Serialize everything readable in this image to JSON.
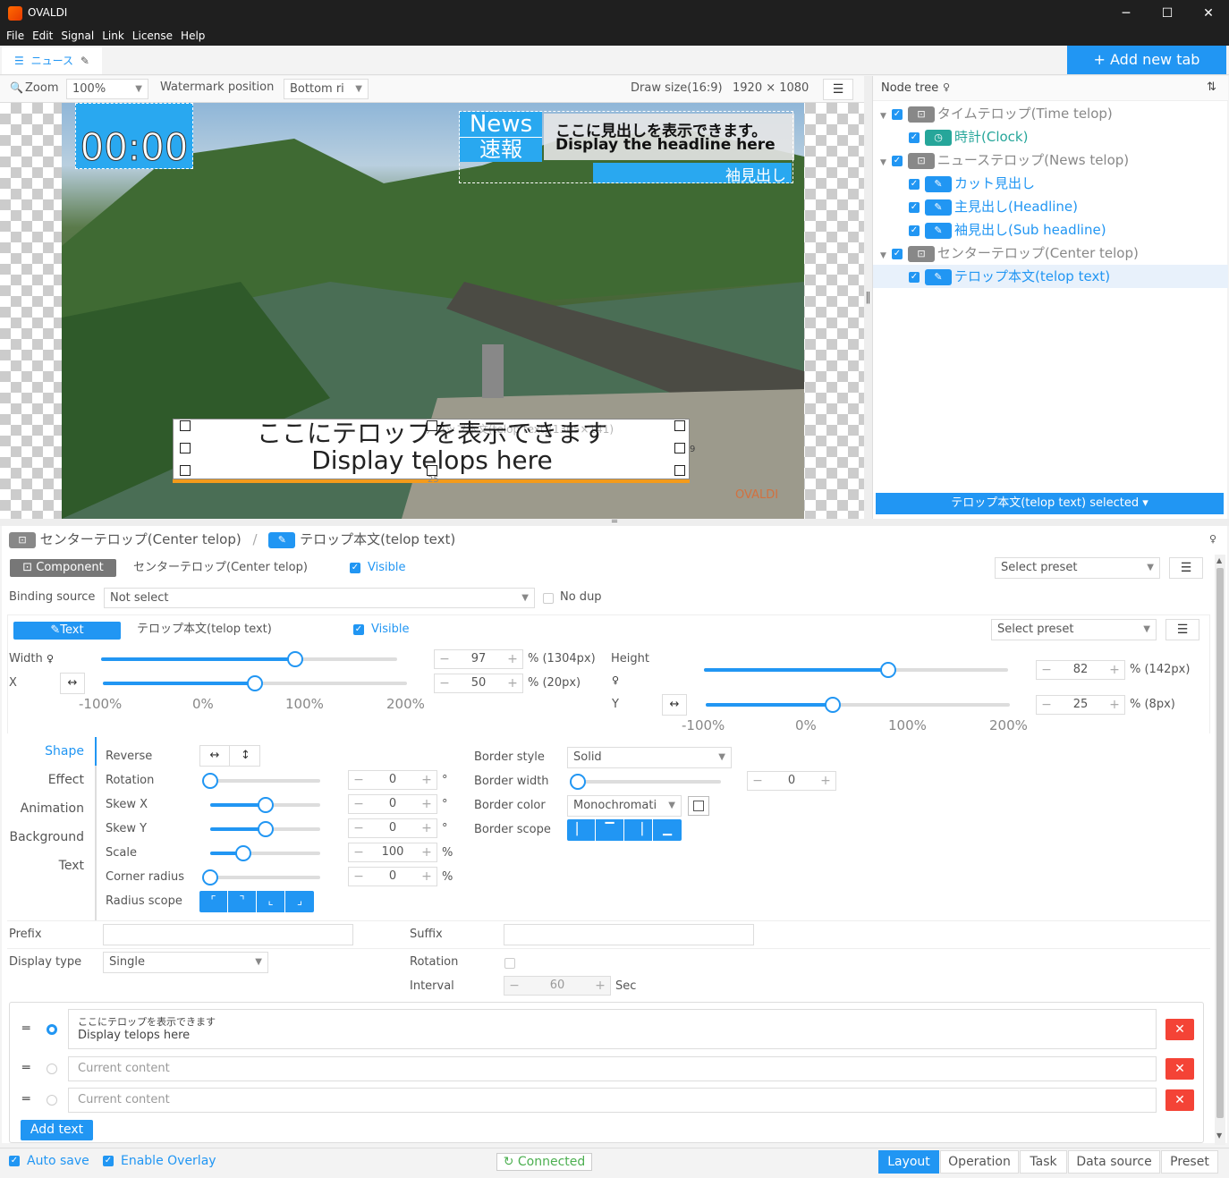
{
  "app": {
    "title": "OVALDI",
    "menu": [
      "File",
      "Edit",
      "Signal",
      "Link",
      "License",
      "Help"
    ]
  },
  "tabs": {
    "active_label": "ニュース",
    "add_label": "+ Add new tab"
  },
  "toolbar": {
    "zoom_label": "Zoom",
    "zoom_value": "100%",
    "watermark_label": "Watermark position",
    "watermark_value": "Bottom ri",
    "draw_size_label": "Draw size(16:9)",
    "draw_size_value": "1920 × 1080"
  },
  "preview": {
    "clock": "00:00",
    "news_top": "News",
    "news_bottom": "速報",
    "headline_jp": "ここに見出しを表示できます。",
    "headline_en": "Display the headline here",
    "subhead": "袖見出し",
    "telop_jp": "ここにテロップを表示できます",
    "telop_en": "Display telops here",
    "telop_overlay": "テロップ本文(telop text)(1305×141)",
    "watermark": "OVALDI",
    "marker_bottom": "25",
    "marker_right": "9"
  },
  "node_tree": {
    "title": "Node tree",
    "items": [
      {
        "label": "タイムテロップ(Time telop)",
        "level": 0,
        "kind": "group"
      },
      {
        "label": "時計(Clock)",
        "level": 1,
        "kind": "clock"
      },
      {
        "label": "ニューステロップ(News telop)",
        "level": 0,
        "kind": "group"
      },
      {
        "label": "カット見出し",
        "level": 1,
        "kind": "text"
      },
      {
        "label": "主見出し(Headline)",
        "level": 1,
        "kind": "text"
      },
      {
        "label": "袖見出し(Sub headline)",
        "level": 1,
        "kind": "text"
      },
      {
        "label": "センターテロップ(Center telop)",
        "level": 0,
        "kind": "group"
      },
      {
        "label": "テロップ本文(telop text)",
        "level": 1,
        "kind": "text",
        "selected": true
      }
    ],
    "selected_button": "テロップ本文(telop text) selected ▾"
  },
  "breadcrumb": {
    "parent": "センターテロップ(Center telop)",
    "separator": "/",
    "current": "テロップ本文(telop text)"
  },
  "component": {
    "badge": "Component",
    "name": "センターテロップ(Center telop)",
    "visible_label": "Visible",
    "preset_placeholder": "Select preset",
    "binding_label": "Binding source",
    "binding_value": "Not select",
    "nodup_label": "No dup"
  },
  "text_node": {
    "badge": "Text",
    "name": "テロップ本文(telop text)",
    "visible_label": "Visible",
    "preset_placeholder": "Select preset"
  },
  "geometry": {
    "width_label": "Width",
    "width_value": "97",
    "width_unit": "% (1304px)",
    "width_percent": 97,
    "x_label": "X",
    "x_value": "50",
    "x_unit": "% (20px)",
    "x_percent": 50,
    "height_label": "Height",
    "height_value": "82",
    "height_unit": "% (142px)",
    "height_percent": 82,
    "y_label": "Y",
    "y_value": "25",
    "y_unit": "% (8px)",
    "y_percent": 25,
    "ticks": [
      "-100%",
      "0%",
      "100%",
      "200%"
    ]
  },
  "side_nav": [
    "Shape",
    "Effect",
    "Animation",
    "Background",
    "Text"
  ],
  "shape": {
    "reverse_label": "Reverse",
    "rows": [
      {
        "label": "Rotation",
        "value": "0",
        "unit": "°",
        "fraction": 0
      },
      {
        "label": "Skew X",
        "value": "0",
        "unit": "°",
        "fraction": 0.5
      },
      {
        "label": "Skew Y",
        "value": "0",
        "unit": "°",
        "fraction": 0.5
      },
      {
        "label": "Scale",
        "value": "100",
        "unit": "%",
        "fraction": 0.3
      },
      {
        "label": "Corner radius",
        "value": "0",
        "unit": "%",
        "fraction": 0
      }
    ],
    "radius_scope_label": "Radius scope",
    "border_style_label": "Border style",
    "border_style_value": "Solid",
    "border_width_label": "Border width",
    "border_width_value": "0",
    "border_color_label": "Border color",
    "border_color_value": "Monochromati",
    "border_scope_label": "Border scope"
  },
  "text_settings": {
    "prefix_label": "Prefix",
    "suffix_label": "Suffix",
    "display_type_label": "Display type",
    "display_type_value": "Single",
    "rotation_label": "Rotation",
    "interval_label": "Interval",
    "interval_value": "60",
    "interval_unit": "Sec"
  },
  "entries": [
    {
      "line1": "ここにテロップを表示できます",
      "line2": "Display telops here",
      "selected": true
    },
    {
      "placeholder": "Current content",
      "selected": false
    },
    {
      "placeholder": "Current content",
      "selected": false
    }
  ],
  "add_text_label": "Add text",
  "status": {
    "auto_save": "Auto save",
    "enable_overlay": "Enable Overlay",
    "connected": "Connected",
    "bottom_tabs": [
      "Layout",
      "Operation",
      "Task",
      "Data source",
      "Preset"
    ],
    "active_tab": "Layout"
  },
  "colors": {
    "accent": "#2196f3",
    "danger": "#f44336",
    "success": "#4caf50"
  }
}
